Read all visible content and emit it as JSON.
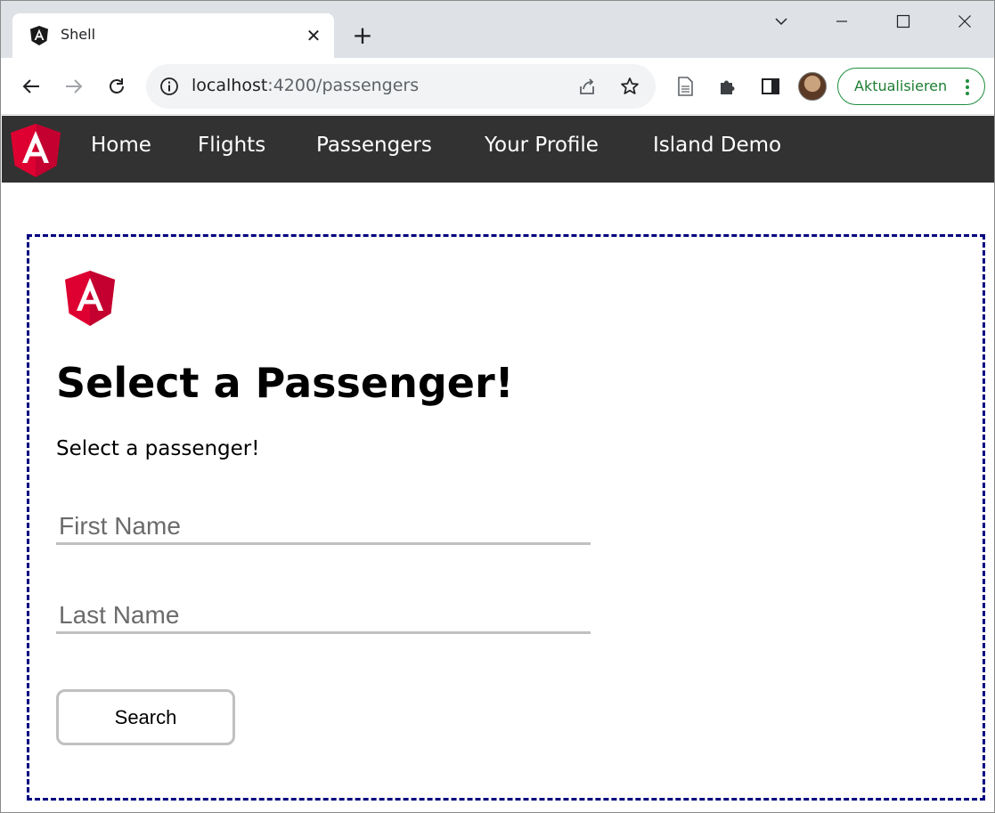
{
  "browser": {
    "tab": {
      "title": "Shell"
    },
    "address": {
      "host": "localhost",
      "rest": ":4200/passengers"
    },
    "update_button": {
      "label": "Aktualisieren",
      "color": "#1e8e3e"
    }
  },
  "app": {
    "nav": {
      "background": "#323232",
      "links": [
        "Home",
        "Flights",
        "Passengers",
        "Your Profile",
        "Island Demo"
      ]
    },
    "logo": {
      "icon": "angular-logo",
      "color": "#dd0031"
    },
    "page": {
      "title": "Select a Passenger!",
      "subtitle": "Select a passenger!",
      "first_name": {
        "placeholder": "First Name",
        "value": ""
      },
      "last_name": {
        "placeholder": "Last Name",
        "value": ""
      },
      "search_label": "Search"
    },
    "island_border_color": "#000080"
  }
}
